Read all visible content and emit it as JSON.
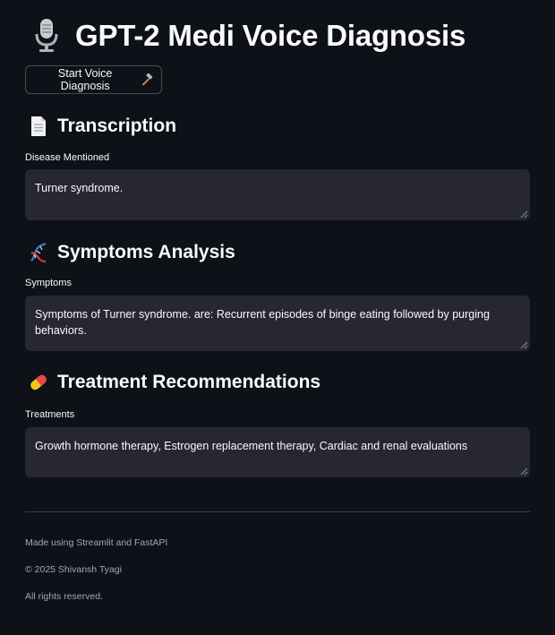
{
  "header": {
    "title": "GPT-2 Medi Voice Diagnosis",
    "icon": "microphone-icon"
  },
  "actions": {
    "start_button_label": "Start Voice Diagnosis",
    "start_button_icon": "hammer-icon"
  },
  "sections": {
    "transcription": {
      "title": "Transcription",
      "icon": "page-icon",
      "field_label": "Disease Mentioned",
      "field_value": "Turner syndrome."
    },
    "symptoms": {
      "title": "Symptoms Analysis",
      "icon": "dna-icon",
      "field_label": "Symptoms",
      "field_value": "Symptoms of Turner syndrome. are: Recurrent episodes of binge eating followed by purging behaviors."
    },
    "treatment": {
      "title": "Treatment Recommendations",
      "icon": "pill-icon",
      "field_label": "Treatments",
      "field_value": "Growth hormone therapy, Estrogen replacement therapy, Cardiac and renal evaluations"
    }
  },
  "footer": {
    "made_using": "Made using Streamlit and FastAPI",
    "copyright": "© 2025 Shivansh Tyagi",
    "rights": "All rights reserved."
  },
  "colors": {
    "background": "#0e1117",
    "input_background": "#262730",
    "text": "#fafafa",
    "muted_text": "#a3a8b4"
  }
}
